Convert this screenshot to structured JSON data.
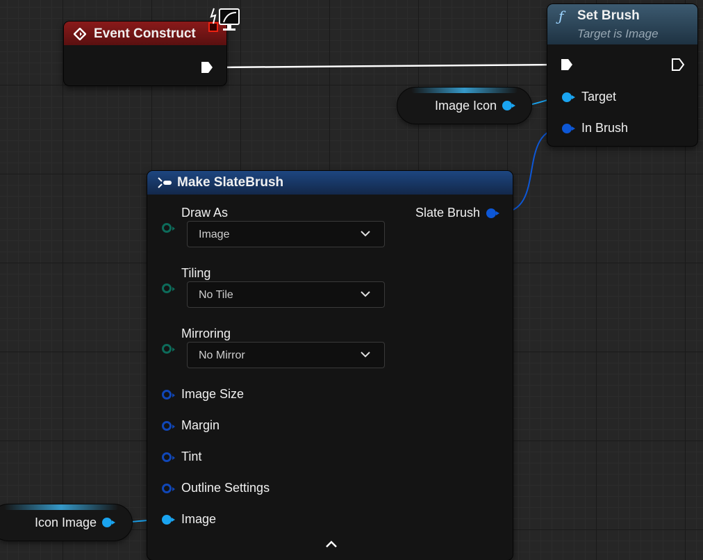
{
  "event_node": {
    "title": "Event Construct",
    "icon": "event-diamond-icon",
    "header_color": "#8a1a1a"
  },
  "set_brush_node": {
    "title": "Set Brush",
    "subtitle": "Target is Image",
    "icon": "function-icon",
    "pins": {
      "target": "Target",
      "in_brush": "In Brush"
    }
  },
  "getters": {
    "image_icon": "Image Icon",
    "icon_image": "Icon Image"
  },
  "make_node": {
    "title": "Make SlateBrush",
    "output": "Slate Brush",
    "fields": {
      "draw_as": {
        "label": "Draw As",
        "value": "Image"
      },
      "tiling": {
        "label": "Tiling",
        "value": "No Tile"
      },
      "mirroring": {
        "label": "Mirroring",
        "value": "No Mirror"
      }
    },
    "pins": {
      "image_size": "Image Size",
      "margin": "Margin",
      "tint": "Tint",
      "outline_settings": "Outline Settings",
      "image": "Image"
    }
  },
  "colors": {
    "exec_wire": "#ffffff",
    "object_pin": "#1aa4f0",
    "struct_pin": "#0d57d6",
    "enum_pin": "#0d6b5a",
    "function_header": "#3c5a70",
    "make_header": "#1d4680"
  }
}
